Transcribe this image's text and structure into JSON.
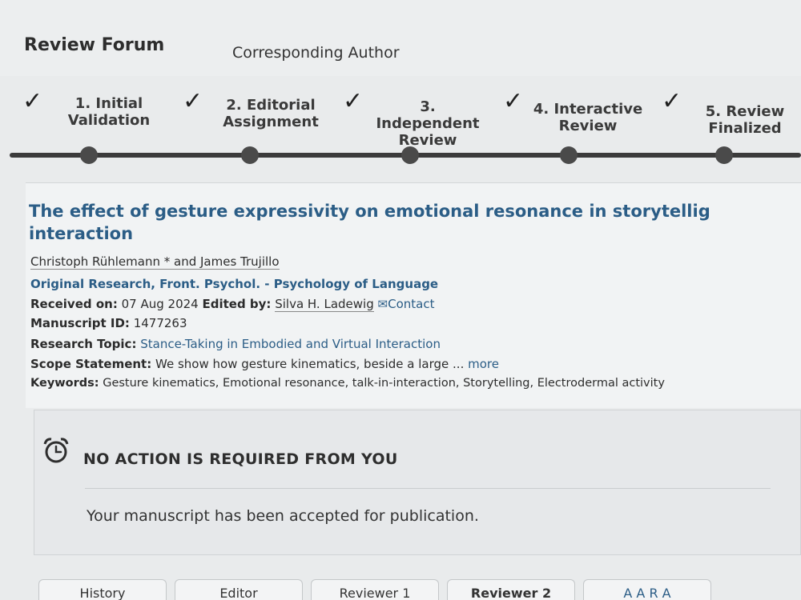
{
  "header": {
    "forum_title": "Review Forum",
    "role": "Corresponding Author"
  },
  "steps": [
    {
      "line1": "1. Initial",
      "line2": "Validation",
      "done": true
    },
    {
      "line1": "2. Editorial",
      "line2": "Assignment",
      "done": true
    },
    {
      "line1": "3. Independent",
      "line2": "Review",
      "done": true
    },
    {
      "line1": "4. Interactive",
      "line2": "Review",
      "done": true
    },
    {
      "line1": "5. Review",
      "line2": "Finalized",
      "done": true
    }
  ],
  "check_glyph": "✓",
  "article": {
    "title": "The effect of gesture expressivity on emotional resonance in storytellig interaction",
    "authors": "Christoph Rühlemann * and James Trujillo",
    "type_journal": "Original Research, Front. Psychol. - Psychology of Language",
    "received_label": "Received on:",
    "received_value": "07 Aug 2024",
    "edited_label": "Edited by:",
    "editor": "Silva H. Ladewig",
    "contact_label": "Contact",
    "manuscript_label": "Manuscript ID:",
    "manuscript_id": "1477263",
    "topic_label": "Research Topic:",
    "topic": "Stance-Taking in Embodied and Virtual Interaction",
    "scope_label": "Scope Statement:",
    "scope": "We show how gesture kinematics, beside a large ...",
    "more_label": "more",
    "keywords_label": "Keywords:",
    "keywords": "Gesture kinematics, Emotional resonance, talk-in-interaction, Storytelling, Electrodermal activity"
  },
  "status": {
    "title": "NO ACTION IS REQUIRED FROM YOU",
    "message": "Your manuscript has been accepted for publication."
  },
  "tabs": [
    "History",
    "Editor",
    "Reviewer 1",
    "Reviewer 2",
    "A A R A"
  ],
  "colors": {
    "link": "#2b5d86",
    "track": "#3b3b3b",
    "background": "#e9ebec"
  }
}
